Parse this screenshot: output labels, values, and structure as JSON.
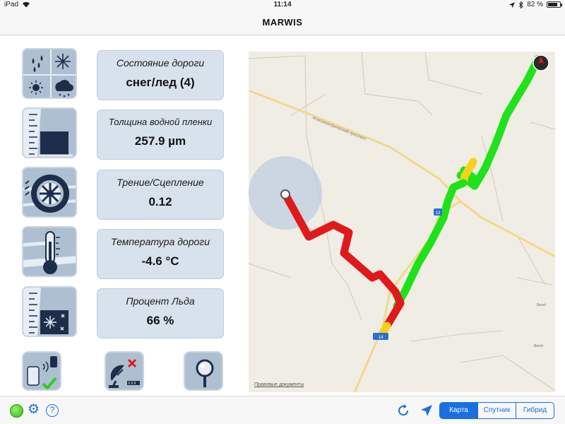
{
  "status_bar": {
    "device": "iPad",
    "time": "11:14",
    "battery": "82 %",
    "battery_level": 0.82
  },
  "nav": {
    "title": "MARWIS"
  },
  "sensors": [
    {
      "icon": "weather-conditions-icon",
      "label": "Состояние дороги",
      "value": "снег/лед (4)"
    },
    {
      "icon": "water-film-icon",
      "label": "Толщина водной пленки",
      "value": "257.9 µm"
    },
    {
      "icon": "tire-icon",
      "label": "Трение/Сцепление",
      "value": "0.12"
    },
    {
      "icon": "thermometer-icon",
      "label": "Температура дороги",
      "value": "-4.6 °C"
    },
    {
      "icon": "ice-percentage-icon",
      "label": "Процент Льда",
      "value": "66 %"
    }
  ],
  "actions": [
    {
      "icon": "device-connected-icon"
    },
    {
      "icon": "satellite-disconnected-icon"
    },
    {
      "icon": "measurement-probe-icon"
    }
  ],
  "map": {
    "legal": "Правовые документы",
    "road_label": "Новоэлектрический проспект",
    "sign_1": "13",
    "sign_2": "14",
    "colors": {
      "green": "#1fe21a",
      "yellow": "#f5d21a",
      "red": "#e01a1a",
      "accuracy": "#b9c8e0"
    }
  },
  "toolbar": {
    "help_symbol": "?",
    "map_modes": [
      {
        "label": "Карта",
        "active": true
      },
      {
        "label": "Спутник",
        "active": false
      },
      {
        "label": "Гибрид",
        "active": false
      }
    ]
  },
  "colors": {
    "accent": "#1a6fe0",
    "status_ok": "#38b51a"
  }
}
